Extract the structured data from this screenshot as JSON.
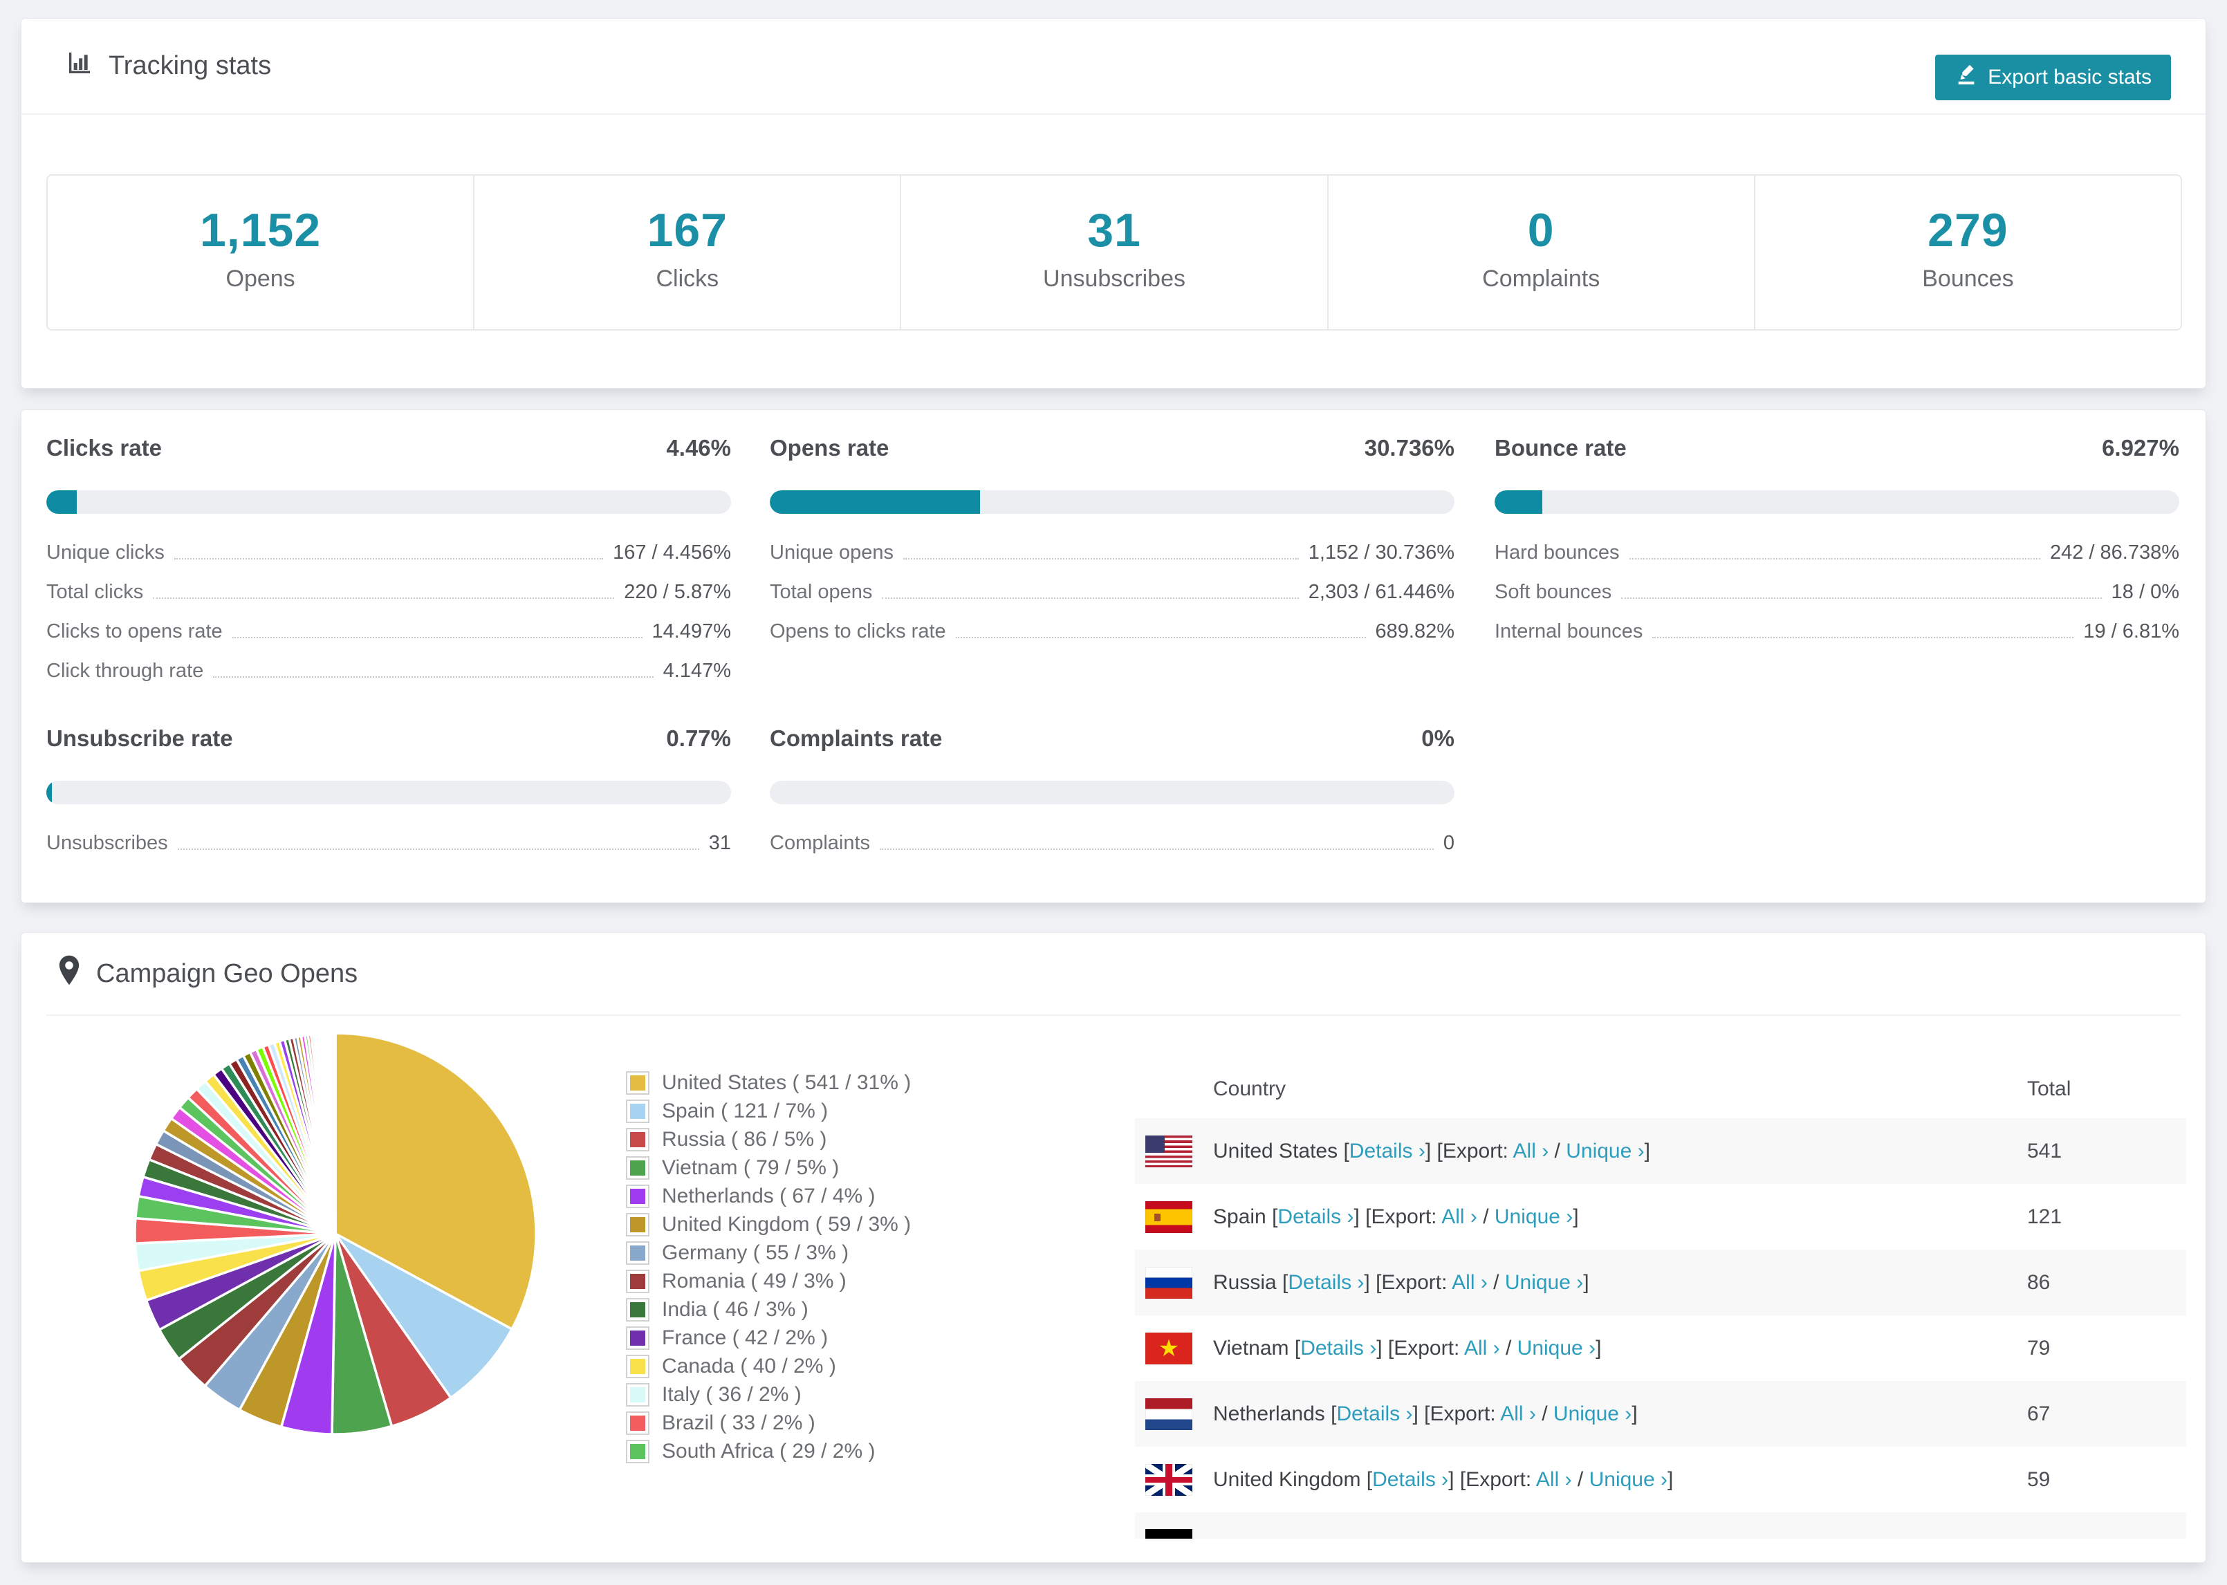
{
  "tracking": {
    "title": "Tracking stats",
    "export_button": "Export basic stats",
    "stats": [
      {
        "value": "1,152",
        "label": "Opens"
      },
      {
        "value": "167",
        "label": "Clicks"
      },
      {
        "value": "31",
        "label": "Unsubscribes"
      },
      {
        "value": "0",
        "label": "Complaints"
      },
      {
        "value": "279",
        "label": "Bounces"
      }
    ]
  },
  "rates": {
    "accent_color": "#0d8ca3",
    "sections": [
      {
        "title": "Clicks rate",
        "value": "4.46%",
        "percent": 4.46,
        "rows": [
          {
            "label": "Unique clicks",
            "value": "167 / 4.456%"
          },
          {
            "label": "Total clicks",
            "value": "220 / 5.87%"
          },
          {
            "label": "Clicks to opens rate",
            "value": "14.497%"
          },
          {
            "label": "Click through rate",
            "value": "4.147%"
          }
        ]
      },
      {
        "title": "Opens rate",
        "value": "30.736%",
        "percent": 30.736,
        "rows": [
          {
            "label": "Unique opens",
            "value": "1,152 / 30.736%"
          },
          {
            "label": "Total opens",
            "value": "2,303 / 61.446%"
          },
          {
            "label": "Opens to clicks rate",
            "value": "689.82%"
          }
        ]
      },
      {
        "title": "Bounce rate",
        "value": "6.927%",
        "percent": 6.927,
        "rows": [
          {
            "label": "Hard bounces",
            "value": "242 / 86.738%"
          },
          {
            "label": "Soft bounces",
            "value": "18 / 0%"
          },
          {
            "label": "Internal bounces",
            "value": "19 / 6.81%"
          }
        ]
      },
      {
        "title": "Unsubscribe rate",
        "value": "0.77%",
        "percent": 0.77,
        "rows": [
          {
            "label": "Unsubscribes",
            "value": "31"
          }
        ]
      },
      {
        "title": "Complaints rate",
        "value": "0%",
        "percent": 0,
        "rows": [
          {
            "label": "Complaints",
            "value": "0"
          }
        ]
      }
    ]
  },
  "geo": {
    "title": "Campaign Geo Opens",
    "columns": {
      "country": "Country",
      "total": "Total"
    },
    "tokens": {
      "bracket_open": "[",
      "bracket_close": "]",
      "details": "Details ›",
      "export_label": "Export:",
      "all": "All ›",
      "slash": "/",
      "unique": "Unique ›"
    },
    "rows": [
      {
        "country": "United States",
        "flag": "us",
        "total": "541",
        "partial": false
      },
      {
        "country": "Spain",
        "flag": "es",
        "total": "121",
        "partial": false
      },
      {
        "country": "Russia",
        "flag": "ru",
        "total": "86",
        "partial": false
      },
      {
        "country": "Vietnam",
        "flag": "vn",
        "total": "79",
        "partial": false
      },
      {
        "country": "Netherlands",
        "flag": "nl",
        "total": "67",
        "partial": false
      },
      {
        "country": "United Kingdom",
        "flag": "gb",
        "total": "59",
        "partial": false
      },
      {
        "country": "",
        "flag": "de",
        "total": "",
        "partial": true
      }
    ]
  },
  "chart_data": {
    "type": "pie",
    "title": "Campaign Geo Opens",
    "legend_position": "right",
    "start_angle_deg": -90,
    "direction": "clockwise",
    "series": [
      {
        "label": "United States",
        "value": 541,
        "pct": "31",
        "color": "#e4bc41"
      },
      {
        "label": "Spain",
        "value": 121,
        "pct": "7",
        "color": "#a8d3f0"
      },
      {
        "label": "Russia",
        "value": 86,
        "pct": "5",
        "color": "#c94a4a"
      },
      {
        "label": "Vietnam",
        "value": 79,
        "pct": "5",
        "color": "#4ea34e"
      },
      {
        "label": "Netherlands",
        "value": 67,
        "pct": "4",
        "color": "#a13bf0"
      },
      {
        "label": "United Kingdom",
        "value": 59,
        "pct": "3",
        "color": "#bd9727"
      },
      {
        "label": "Germany",
        "value": 55,
        "pct": "3",
        "color": "#88a9cb"
      },
      {
        "label": "Romania",
        "value": 49,
        "pct": "3",
        "color": "#9e3c3c"
      },
      {
        "label": "India",
        "value": 46,
        "pct": "3",
        "color": "#39783a"
      },
      {
        "label": "France",
        "value": 42,
        "pct": "2",
        "color": "#7030ad"
      },
      {
        "label": "Canada",
        "value": 40,
        "pct": "2",
        "color": "#f9e14b"
      },
      {
        "label": "Italy",
        "value": 36,
        "pct": "2",
        "color": "#d8fbfa"
      },
      {
        "label": "Brazil",
        "value": 33,
        "pct": "2",
        "color": "#f25c5c"
      },
      {
        "label": "South Africa",
        "value": 29,
        "pct": "2",
        "color": "#5bc45e"
      }
    ],
    "unlabeled_tail": {
      "note": "remaining smaller countries drawn as shrinking unlabeled slices",
      "values": [
        26,
        24,
        22,
        20,
        19,
        18,
        17,
        16,
        15,
        14,
        13,
        12,
        11,
        10,
        10,
        9,
        9,
        8,
        8,
        7,
        7,
        6,
        6,
        5,
        5,
        5,
        4,
        4,
        4,
        3,
        3,
        3,
        3,
        2,
        2,
        2,
        2,
        2,
        1,
        1,
        1,
        1,
        1,
        1
      ],
      "colors": [
        "#9b3ff0",
        "#39783a",
        "#9e3c3c",
        "#7a95b8",
        "#bd9727",
        "#e44fe4",
        "#5bc45e",
        "#f25c5c",
        "#d8fbfa",
        "#f9e14b",
        "#4b0082",
        "#2e8b57",
        "#8b2323",
        "#4682b4",
        "#808000",
        "#da70d6",
        "#7cfc00",
        "#ff4d4d",
        "#cfe8ff",
        "#ffe84d"
      ]
    }
  }
}
